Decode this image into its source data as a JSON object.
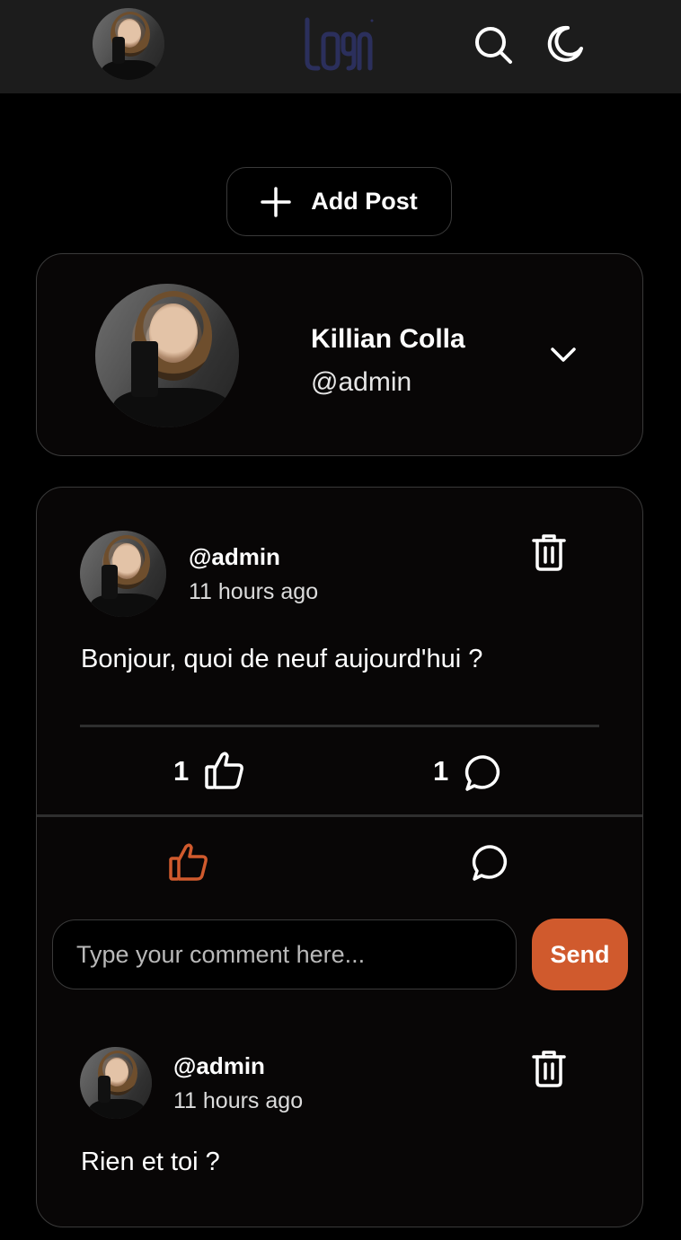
{
  "header": {
    "logo_alt": "logo",
    "icons": [
      "avatar",
      "search-icon",
      "moon-icon"
    ]
  },
  "add_post": {
    "label": "Add Post"
  },
  "profile": {
    "name": "Killian Colla",
    "handle": "@admin"
  },
  "post": {
    "user": "@admin",
    "time": "11 hours ago",
    "text": "Bonjour, quoi de neuf aujourd'hui ?",
    "likes": "1",
    "comments": "1"
  },
  "comment_form": {
    "placeholder": "Type your comment here...",
    "send_label": "Send"
  },
  "comments": [
    {
      "user": "@admin",
      "time": "11 hours ago",
      "text": "Rien et toi ?"
    }
  ],
  "colors": {
    "accent": "#d05a2d",
    "logo": "#2b2f5c",
    "background": "#000000",
    "topbar": "#1c1c1c"
  }
}
